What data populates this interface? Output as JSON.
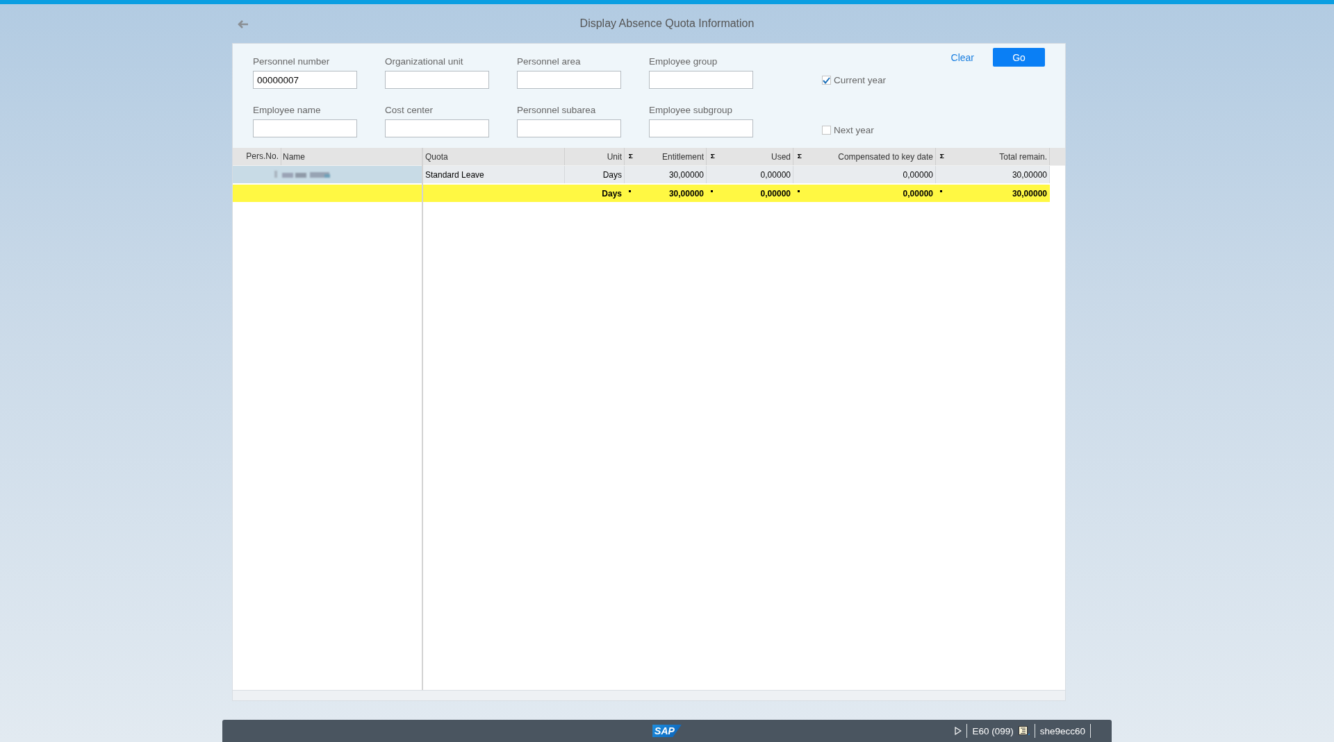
{
  "header": {
    "title": "Display Absence Quota Information"
  },
  "filters": [
    {
      "label": "Personnel number",
      "value": "00000007"
    },
    {
      "label": "Organizational unit"
    },
    {
      "label": "Personnel area"
    },
    {
      "label": "Employee group"
    },
    {
      "label": "Employee name"
    },
    {
      "label": "Cost center"
    },
    {
      "label": "Personnel subarea"
    },
    {
      "label": "Employee subgroup"
    }
  ],
  "options": [
    {
      "label": "Current year",
      "checked": true
    },
    {
      "label": "Next year",
      "checked": false
    }
  ],
  "actions": {
    "clear": "Clear",
    "go": "Go"
  },
  "table": {
    "left_columns": [
      "Pers.No.",
      "Name"
    ],
    "columns": [
      {
        "label": "Quota"
      },
      {
        "label": "Unit"
      },
      {
        "label": "Entitlement",
        "sum": true
      },
      {
        "label": "Used",
        "sum": true
      },
      {
        "label": "Compensated to key date",
        "sum": true
      },
      {
        "label": "Total remain.",
        "sum": true
      }
    ],
    "rows": [
      {
        "kind": "item",
        "selected": true,
        "cells": [
          "Standard Leave",
          "Days",
          "30,00000",
          "0,00000",
          "0,00000",
          "30,00000"
        ]
      },
      {
        "kind": "total",
        "selected": false,
        "cells": [
          "",
          "Days",
          "30,00000",
          "0,00000",
          "0,00000",
          "30,00000"
        ]
      }
    ]
  },
  "status_bar": {
    "logo": "SAP",
    "system": "E60 (099)",
    "server": "she9ecc60"
  }
}
